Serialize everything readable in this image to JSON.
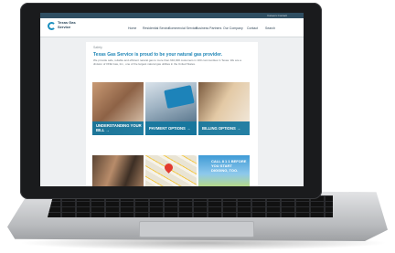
{
  "site": {
    "logo_text": "Texas Gas Service",
    "utility_links": "Careers   Contact",
    "nav_items": [
      "Home",
      "Residential Service",
      "Commercial Service",
      "Business Partners",
      "Our Company",
      "Contact",
      "Search"
    ]
  },
  "page": {
    "breadcrumb": "Safety",
    "headline": "Texas Gas Service is proud to be your natural gas provider.",
    "intro": "We provide safe, reliable and efficient natural gas to more than 640,000 customers in 100 communities in Texas. We are a division of ONE Gas, Inc., one of the largest natural gas utilities in the United States."
  },
  "tiles": [
    {
      "label": "UNDERSTANDING YOUR BILL →",
      "image": "family-reading-bill"
    },
    {
      "label": "PAYMENT OPTIONS →",
      "image": "payment-options-keyboard"
    },
    {
      "label": "BILLING OPTIONS →",
      "image": "woman-kitchen"
    },
    {
      "label": "",
      "image": "family-portrait"
    },
    {
      "label": "",
      "image": "map-pin"
    },
    {
      "label": "CALL 8 1 1 BEFORE YOU START DIGGING, TOO.",
      "image": "call-811-banner"
    }
  ],
  "colors": {
    "brand_blue": "#1e85b6",
    "header_dark": "#2f4e62",
    "tile_overlay": "#12769e"
  }
}
